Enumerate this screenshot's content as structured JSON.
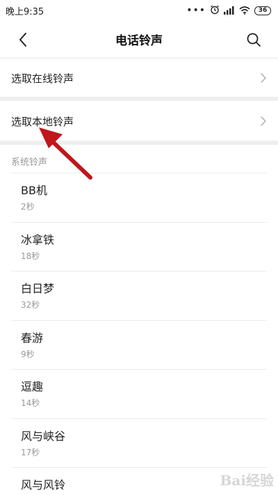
{
  "status_bar": {
    "time": "晚上9:35",
    "dots": "•••",
    "battery": "36",
    "icons": [
      "alarm-icon",
      "signal-icon",
      "wifi-icon",
      "battery-icon"
    ]
  },
  "header": {
    "title": "电话铃声",
    "back_icon": "chevron-left-icon",
    "search_icon": "search-icon"
  },
  "options": [
    {
      "label": "选取在线铃声",
      "icon": "chevron-right-icon"
    },
    {
      "label": "选取本地铃声",
      "icon": "chevron-right-icon"
    }
  ],
  "section": {
    "label": "系统铃声"
  },
  "ringtones": [
    {
      "name": "BB机",
      "duration": "2秒"
    },
    {
      "name": "冰拿铁",
      "duration": "18秒"
    },
    {
      "name": "白日梦",
      "duration": "32秒"
    },
    {
      "name": "春游",
      "duration": "9秒"
    },
    {
      "name": "逗趣",
      "duration": "14秒"
    },
    {
      "name": "风与峡谷",
      "duration": "17秒"
    },
    {
      "name": "风与风铃",
      "duration": ""
    }
  ],
  "annotation": {
    "color": "#c0161c"
  },
  "watermark": {
    "text": "Bai经验"
  }
}
